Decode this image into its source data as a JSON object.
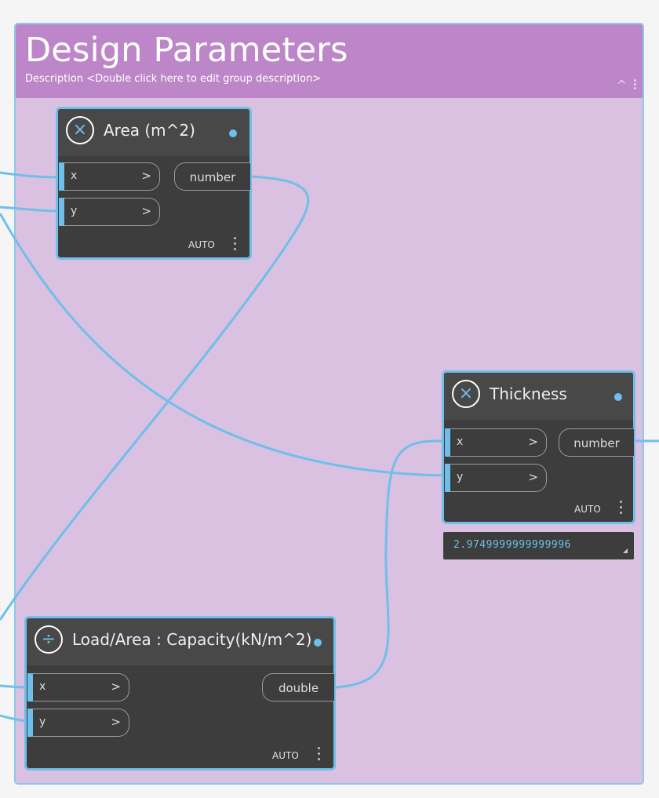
{
  "group": {
    "title": "Design Parameters",
    "description": "Description <Double click here to edit group description>",
    "collapse_glyph": "^"
  },
  "colors": {
    "background": "#f5f5f5",
    "group_body": "#dac0e1",
    "group_header": "#bd86c8",
    "node_body": "#3d3d3d",
    "node_border": "#6fbfea",
    "wire": "#6fbfea"
  },
  "nodes": {
    "area": {
      "icon": "multiply-icon",
      "icon_glyph": "×",
      "title": "Area (m^2)",
      "inputs": [
        {
          "label": "x",
          "arrow": ">"
        },
        {
          "label": "y",
          "arrow": ">"
        }
      ],
      "output": "number",
      "lacing": "AUTO"
    },
    "thickness": {
      "icon": "multiply-icon",
      "icon_glyph": "×",
      "title": "Thickness",
      "inputs": [
        {
          "label": "x",
          "arrow": ">"
        },
        {
          "label": "y",
          "arrow": ">"
        }
      ],
      "output": "number",
      "lacing": "AUTO",
      "preview_value": "2.9749999999999996"
    },
    "capacity": {
      "icon": "divide-icon",
      "icon_glyph": "÷",
      "title": "Load/Area : Capacity(kN/m^2)",
      "inputs": [
        {
          "label": "x",
          "arrow": ">"
        },
        {
          "label": "y",
          "arrow": ">"
        }
      ],
      "output": "double",
      "lacing": "AUTO"
    }
  }
}
